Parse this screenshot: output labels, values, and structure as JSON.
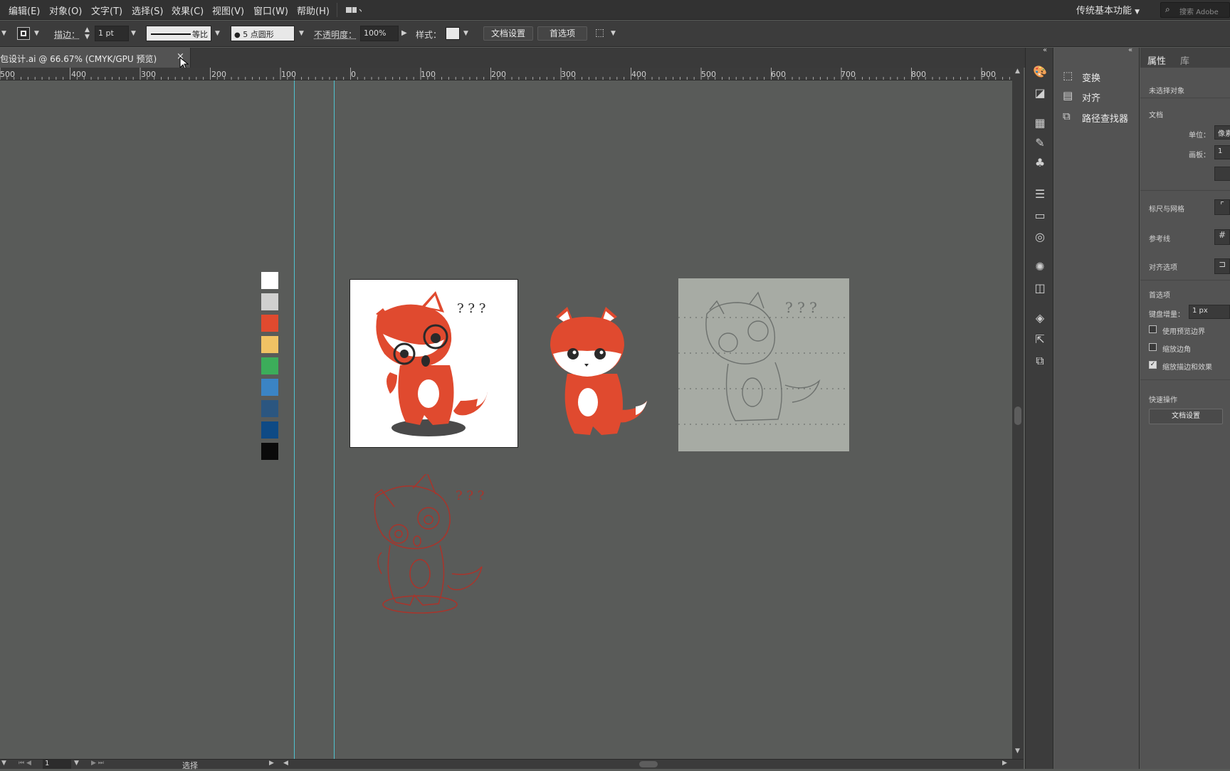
{
  "menubar": {
    "items": [
      "编辑(E)",
      "对象(O)",
      "文字(T)",
      "选择(S)",
      "效果(C)",
      "视图(V)",
      "窗口(W)",
      "帮助(H)"
    ],
    "workspace": "传统基本功能",
    "search_placeholder": "搜索 Adobe"
  },
  "controlbar": {
    "stroke_label": "描边：",
    "stroke_value": "1 pt",
    "profile_label": "等比",
    "brush_label": "5 点圆形",
    "opacity_label": "不透明度：",
    "opacity_value": "100%",
    "style_label": "样式：",
    "doc_setup_button": "文档设置",
    "prefs_button": "首选项"
  },
  "document_tab": {
    "title": "包设计.ai @ 66.67% (CMYK/GPU 预览)",
    "close": "×"
  },
  "ruler": {
    "labels": [
      "500",
      "400",
      "300",
      "200",
      "100",
      "0",
      "100",
      "200",
      "300",
      "400",
      "500",
      "600",
      "700",
      "800",
      "900"
    ]
  },
  "swatches": [
    "#ffffff",
    "#d0d0cf",
    "#e04a2f",
    "#f0c264",
    "#3cad5a",
    "#3b84c4",
    "#2b5680",
    "#0e4a85",
    "#0a0a0a"
  ],
  "collapsed_panels": {
    "items": [
      "变换",
      "对齐",
      "路径查找器"
    ]
  },
  "props": {
    "tabs": [
      "属性",
      "库"
    ],
    "no_selection": "未选择对象",
    "document_section": "文档",
    "units_label": "单位：",
    "units_value": "像素",
    "artboard_label": "画板：",
    "artboard_value": "1",
    "rulers_grid": "标尺与网格",
    "guides": "参考线",
    "snap_options": "对齐选项",
    "preferences": "首选项",
    "keyboard_increment_label": "键盘增量：",
    "keyboard_increment_value": "1 px",
    "checkbox_preview_bounds": "使用预览边界",
    "checkbox_scale_corners": "缩放边角",
    "checkbox_scale_strokes": "缩放描边和效果",
    "quick_actions": "快速操作",
    "doc_setup_button": "文档设置"
  },
  "statusbar": {
    "page_value": "1",
    "tool_label": "选择"
  },
  "sketch": {
    "question_marks": "? ? ?"
  }
}
